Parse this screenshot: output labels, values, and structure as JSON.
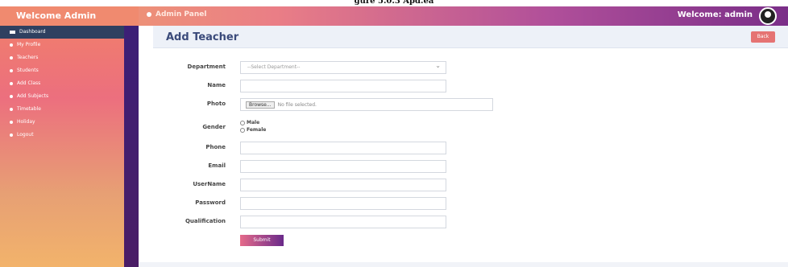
{
  "caption": "gure 5.0.3 Apd.ea",
  "topbar": {
    "brand": "Welcome Admin",
    "panel_title": "Admin Panel",
    "welcome": "Welcome: admin"
  },
  "sidebar": {
    "items": [
      {
        "label": "Dashboard"
      },
      {
        "label": "My Profile"
      },
      {
        "label": "Teachers"
      },
      {
        "label": "Students"
      },
      {
        "label": "Add Class"
      },
      {
        "label": "Add Subjects"
      },
      {
        "label": "Timetable"
      },
      {
        "label": "Holiday"
      },
      {
        "label": "Logout"
      }
    ]
  },
  "header": {
    "title": "Add Teacher",
    "back_label": "Back"
  },
  "form": {
    "department_label": "Department",
    "department_value": "--Select Department--",
    "name_label": "Name",
    "photo_label": "Photo",
    "browse_label": "Browse...",
    "no_file_text": "No file selected.",
    "gender_label": "Gender",
    "gender_male": "Male",
    "gender_female": "Female",
    "phone_label": "Phone",
    "email_label": "Email",
    "username_label": "UserName",
    "password_label": "Password",
    "qualification_label": "Qualification",
    "submit_label": "Submit"
  }
}
